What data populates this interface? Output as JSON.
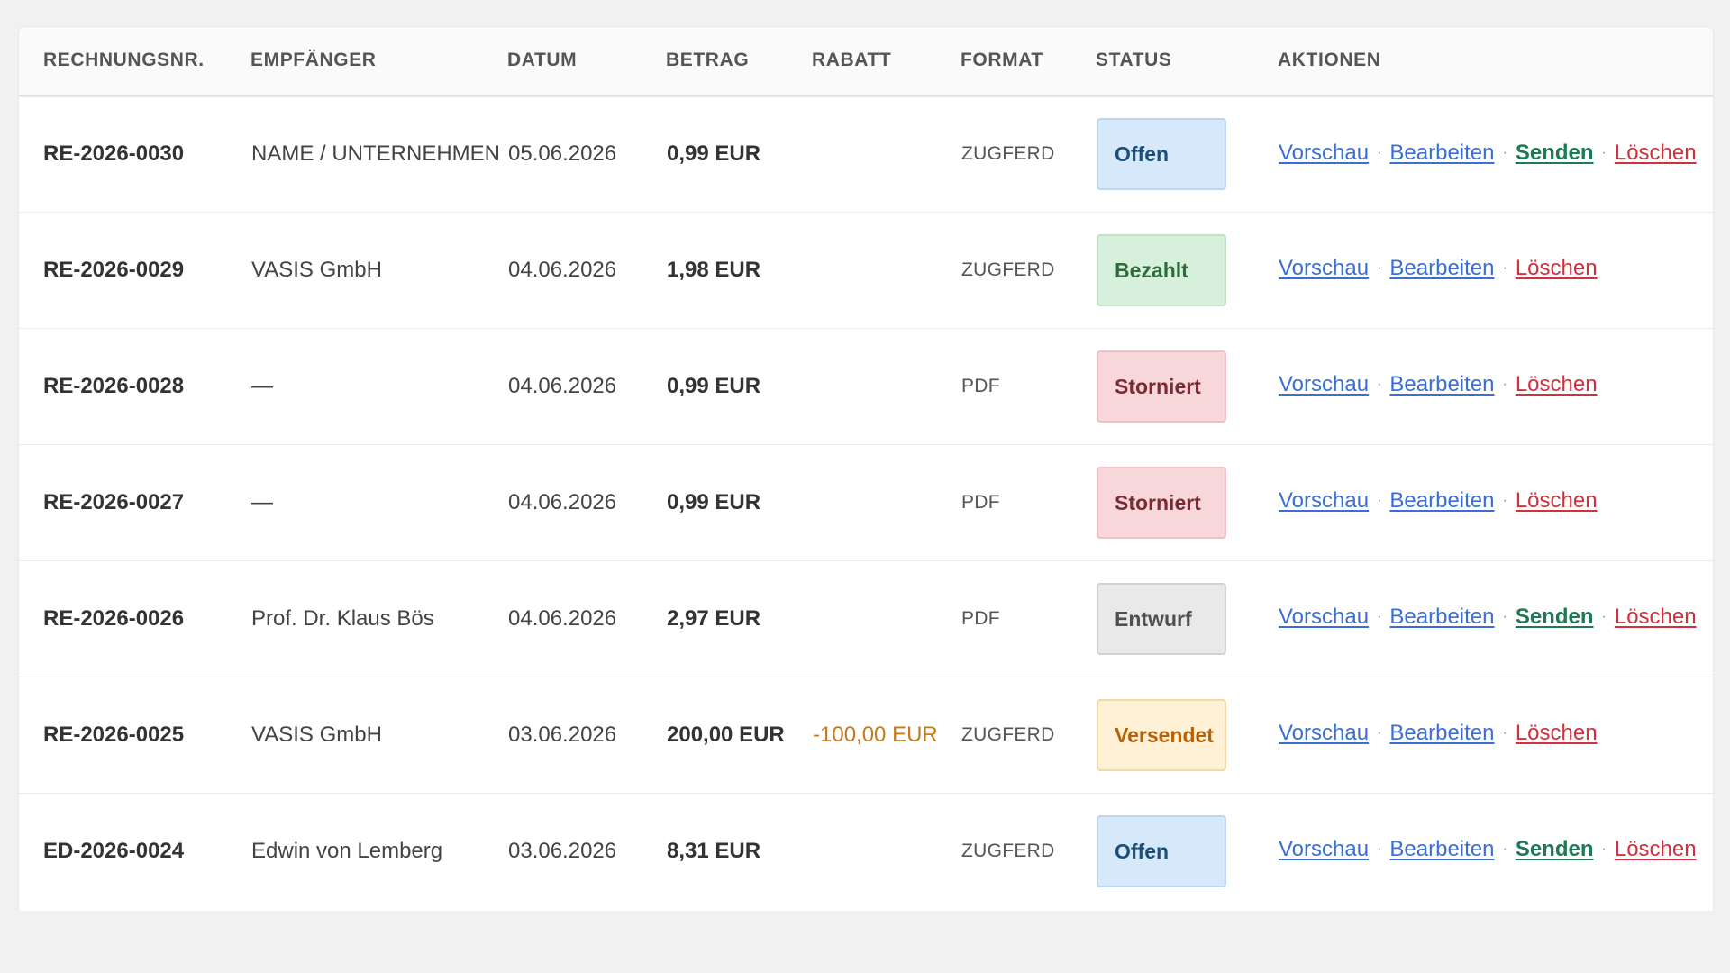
{
  "table": {
    "headers": {
      "number": "RECHNUNGSNR.",
      "recipient": "EMPFÄNGER",
      "date": "DATUM",
      "amount": "BETRAG",
      "discount": "RABATT",
      "format": "FORMAT",
      "status": "STATUS",
      "actions": "AKTIONEN"
    },
    "action_labels": {
      "preview": "Vorschau",
      "edit": "Bearbeiten",
      "send": "Senden",
      "delete": "Löschen",
      "separator": "·"
    },
    "rows": [
      {
        "number": "RE-2026-0030",
        "recipient": "NAME / UNTERNEHMEN",
        "date": "05.06.2026",
        "amount": "0,99 EUR",
        "discount": "",
        "format": "ZUGFERD",
        "status": "Offen",
        "status_key": "offen",
        "can_send": true
      },
      {
        "number": "RE-2026-0029",
        "recipient": "VASIS GmbH",
        "date": "04.06.2026",
        "amount": "1,98 EUR",
        "discount": "",
        "format": "ZUGFERD",
        "status": "Bezahlt",
        "status_key": "bezahlt",
        "can_send": false
      },
      {
        "number": "RE-2026-0028",
        "recipient": "—",
        "date": "04.06.2026",
        "amount": "0,99 EUR",
        "discount": "",
        "format": "PDF",
        "status": "Storniert",
        "status_key": "storniert",
        "can_send": false
      },
      {
        "number": "RE-2026-0027",
        "recipient": "—",
        "date": "04.06.2026",
        "amount": "0,99 EUR",
        "discount": "",
        "format": "PDF",
        "status": "Storniert",
        "status_key": "storniert",
        "can_send": false
      },
      {
        "number": "RE-2026-0026",
        "recipient": "Prof. Dr. Klaus Bös",
        "date": "04.06.2026",
        "amount": "2,97 EUR",
        "discount": "",
        "format": "PDF",
        "status": "Entwurf",
        "status_key": "entwurf",
        "can_send": true
      },
      {
        "number": "RE-2026-0025",
        "recipient": "VASIS GmbH",
        "date": "03.06.2026",
        "amount": "200,00 EUR",
        "discount": "-100,00 EUR",
        "format": "ZUGFERD",
        "status": "Versendet",
        "status_key": "versendet",
        "can_send": false
      },
      {
        "number": "ED-2026-0024",
        "recipient": "Edwin von Lemberg",
        "date": "03.06.2026",
        "amount": "8,31 EUR",
        "discount": "",
        "format": "ZUGFERD",
        "status": "Offen",
        "status_key": "offen",
        "can_send": true
      }
    ]
  },
  "colors": {
    "link": "#3b6fd6",
    "send": "#1e7a55",
    "delete": "#d0313d",
    "discount": "#c77a1a"
  }
}
